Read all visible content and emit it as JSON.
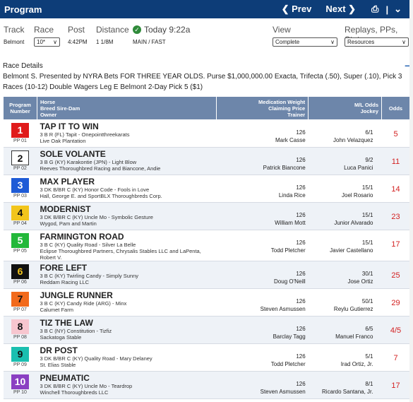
{
  "topbar": {
    "title": "Program",
    "prev_label": "Prev",
    "next_label": "Next"
  },
  "filters": {
    "track_label": "Track",
    "track_value": "Belmont",
    "race_label": "Race",
    "race_value": "10*",
    "post_label": "Post",
    "post_value": "4:42PM",
    "distance_label": "Distance",
    "distance_value": "1 1/8M",
    "today_label": "Today 9:22a",
    "surface_value": "MAIN / FAST",
    "view_label": "View",
    "view_value": "Complete",
    "replays_label": "Replays, PPs, Stats",
    "replays_value": "Resources"
  },
  "race_details": {
    "heading": "Race Details",
    "text": "Belmont S. Presented by NYRA Bets FOR THREE YEAR OLDS. Purse $1,000,000.00 Exacta, Trifecta (.50), Super (.10), Pick 3 Races (10-12) Double Wagers Leg E Belmont 2-Day Pick 5 ($1)"
  },
  "table": {
    "headers": {
      "program": "Program Number",
      "horse": "Horse\nBreed Sire-Dam\nOwner",
      "med": "Medication Weight\nClaiming Price\nTrainer",
      "ml": "M/L Odds\nJockey",
      "odds": "Odds"
    },
    "rows": [
      {
        "num": "1",
        "pp": "PP 01",
        "bg": "#e01b1b",
        "fg": "#ffffff",
        "name": "TAP IT TO WIN",
        "breed": "3 B R (FL) Tapit - Onepointthreekarats",
        "owner": "Live Oak Plantation",
        "weight": "126",
        "trainer": "Mark Casse",
        "ml": "6/1",
        "jockey": "John Velazquez",
        "odds": "5"
      },
      {
        "num": "2",
        "pp": "PP 02",
        "bg": "#ffffff",
        "fg": "#111111",
        "name": "SOLE VOLANTE",
        "breed": "3 B G (KY) Karakontie (JPN) - Light Blow",
        "owner": "Reeves Thoroughbred Racing and Biancone, Andie",
        "weight": "126",
        "trainer": "Patrick Biancone",
        "ml": "9/2",
        "jockey": "Luca Panici",
        "odds": "11"
      },
      {
        "num": "3",
        "pp": "PP 03",
        "bg": "#1e5bd6",
        "fg": "#ffffff",
        "name": "MAX PLAYER",
        "breed": "3 DK B/BR C (KY) Honor Code - Fools in Love",
        "owner": "Hall, George E. and SportBLX Thoroughbreds Corp.",
        "weight": "126",
        "trainer": "Linda Rice",
        "ml": "15/1",
        "jockey": "Joel Rosario",
        "odds": "14"
      },
      {
        "num": "4",
        "pp": "PP 04",
        "bg": "#f2c51c",
        "fg": "#111111",
        "name": "MODERNIST",
        "breed": "3 DK B/BR C (KY) Uncle Mo - Symbolic Gesture",
        "owner": "Wygod, Pam and Martin",
        "weight": "126",
        "trainer": "William Mott",
        "ml": "15/1",
        "jockey": "Junior Alvarado",
        "odds": "23"
      },
      {
        "num": "5",
        "pp": "PP 05",
        "bg": "#23b83a",
        "fg": "#ffffff",
        "name": "FARMINGTON ROAD",
        "breed": "3 B C (KY) Quality Road - Silver La Belle",
        "owner": "Eclipse Thoroughbred Partners, Chrysalis Stables LLC and LaPenta, Robert V.",
        "weight": "126",
        "trainer": "Todd Pletcher",
        "ml": "15/1",
        "jockey": "Javier Castellano",
        "odds": "17"
      },
      {
        "num": "6",
        "pp": "PP 06",
        "bg": "#111111",
        "fg": "#f2c51c",
        "name": "FORE LEFT",
        "breed": "3 B C (KY) Twirling Candy - Simply Sunny",
        "owner": "Reddam Racing LLC",
        "weight": "126",
        "trainer": "Doug O'Neill",
        "ml": "30/1",
        "jockey": "Jose Ortiz",
        "odds": "25"
      },
      {
        "num": "7",
        "pp": "PP 07",
        "bg": "#f26a1b",
        "fg": "#111111",
        "name": "JUNGLE RUNNER",
        "breed": "3 B C (KY) Candy Ride (ARG) - Minx",
        "owner": "Calumet Farm",
        "weight": "126",
        "trainer": "Steven Asmussen",
        "ml": "50/1",
        "jockey": "Reylu Gutierrez",
        "odds": "29"
      },
      {
        "num": "8",
        "pp": "PP 08",
        "bg": "#f7c6cf",
        "fg": "#111111",
        "name": "TIZ THE LAW",
        "breed": "3 B C (NY) Constitution - Tizfiz",
        "owner": "Sackatoga Stable",
        "weight": "126",
        "trainer": "Barclay Tagg",
        "ml": "6/5",
        "jockey": "Manuel Franco",
        "odds": "4/5"
      },
      {
        "num": "9",
        "pp": "PP 09",
        "bg": "#1bbfb0",
        "fg": "#111111",
        "name": "DR POST",
        "breed": "3 DK B/BR C (KY) Quality Road - Mary Delaney",
        "owner": "St. Elias Stable",
        "weight": "126",
        "trainer": "Todd Pletcher",
        "ml": "5/1",
        "jockey": "Irad Ortiz, Jr.",
        "odds": "7"
      },
      {
        "num": "10",
        "pp": "PP 10",
        "bg": "#8a3fc2",
        "fg": "#ffffff",
        "name": "PNEUMATIC",
        "breed": "3 DK B/BR C (KY) Uncle Mo - Teardrop",
        "owner": "Winchell Thoroughbreds LLC",
        "weight": "126",
        "trainer": "Steven Asmussen",
        "ml": "8/1",
        "jockey": "Ricardo Santana, Jr.",
        "odds": "17"
      }
    ]
  }
}
